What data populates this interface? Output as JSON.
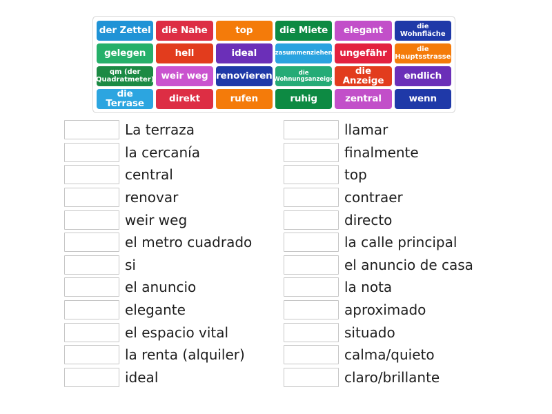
{
  "activity": {
    "type": "match-up",
    "tile_panel": {
      "rows": [
        [
          {
            "label": "der Zettel",
            "color": "#2093d6",
            "size": "md"
          },
          {
            "label": "die Nahe",
            "color": "#dd2e44",
            "size": "md"
          },
          {
            "label": "top",
            "color": "#f47b0a",
            "size": "md"
          },
          {
            "label": "die Miete",
            "color": "#0d8a43",
            "size": "md"
          },
          {
            "label": "elegant",
            "color": "#c24fc9",
            "size": "md"
          },
          {
            "label": "die Wohnfläche",
            "color": "#1f39a8",
            "size": "sm"
          }
        ],
        [
          {
            "label": "gelegen",
            "color": "#26b06a",
            "size": "md"
          },
          {
            "label": "hell",
            "color": "#e23c1d",
            "size": "md"
          },
          {
            "label": "ideal",
            "color": "#6b2fb8",
            "size": "md"
          },
          {
            "label": "zasummenziehen",
            "color": "#2aa3e0",
            "size": "xs"
          },
          {
            "label": "ungefähr",
            "color": "#e3213f",
            "size": "md"
          },
          {
            "label": "die\nHauptsstrasse",
            "color": "#f47b0a",
            "size": "sm"
          }
        ],
        [
          {
            "label": "qm (der\nQuadratmeter)",
            "color": "#1b8a44",
            "size": "sm"
          },
          {
            "label": "weir weg",
            "color": "#ca53cf",
            "size": "md"
          },
          {
            "label": "renovieren",
            "color": "#1f39a8",
            "size": "md"
          },
          {
            "label": "die\nWohnungsanzeige",
            "color": "#25ab76",
            "size": "xs"
          },
          {
            "label": "die Anzeige",
            "color": "#e23c1d",
            "size": "md"
          },
          {
            "label": "endlich",
            "color": "#6b2fb8",
            "size": "md"
          }
        ],
        [
          {
            "label": "die Terrase",
            "color": "#2ca5e0",
            "size": "md"
          },
          {
            "label": "direkt",
            "color": "#dd2e44",
            "size": "md"
          },
          {
            "label": "rufen",
            "color": "#f47b0a",
            "size": "md"
          },
          {
            "label": "ruhig",
            "color": "#0d8a43",
            "size": "md"
          },
          {
            "label": "zentral",
            "color": "#c24fc9",
            "size": "md"
          },
          {
            "label": "wenn",
            "color": "#1f39a8",
            "size": "md"
          }
        ]
      ]
    },
    "answers": {
      "left_column": [
        {
          "box_value": "",
          "label": "La terraza"
        },
        {
          "box_value": "",
          "label": "la cercanía"
        },
        {
          "box_value": "",
          "label": "central"
        },
        {
          "box_value": "",
          "label": "renovar"
        },
        {
          "box_value": "",
          "label": "weir weg"
        },
        {
          "box_value": "",
          "label": "el metro cuadrado"
        },
        {
          "box_value": "",
          "label": "si"
        },
        {
          "box_value": "",
          "label": "el anuncio"
        },
        {
          "box_value": "",
          "label": "elegante"
        },
        {
          "box_value": "",
          "label": "el espacio vital"
        },
        {
          "box_value": "",
          "label": "la renta (alquiler)"
        },
        {
          "box_value": "",
          "label": "ideal"
        }
      ],
      "right_column": [
        {
          "box_value": "",
          "label": "llamar"
        },
        {
          "box_value": "",
          "label": "finalmente"
        },
        {
          "box_value": "",
          "label": "top"
        },
        {
          "box_value": "",
          "label": "contraer"
        },
        {
          "box_value": "",
          "label": "directo"
        },
        {
          "box_value": "",
          "label": "la calle principal"
        },
        {
          "box_value": "",
          "label": "el anuncio de casa"
        },
        {
          "box_value": "",
          "label": "la nota"
        },
        {
          "box_value": "",
          "label": "aproximado"
        },
        {
          "box_value": "",
          "label": "situado"
        },
        {
          "box_value": "",
          "label": "calma/quieto"
        },
        {
          "box_value": "",
          "label": "claro/brillante"
        }
      ]
    }
  }
}
